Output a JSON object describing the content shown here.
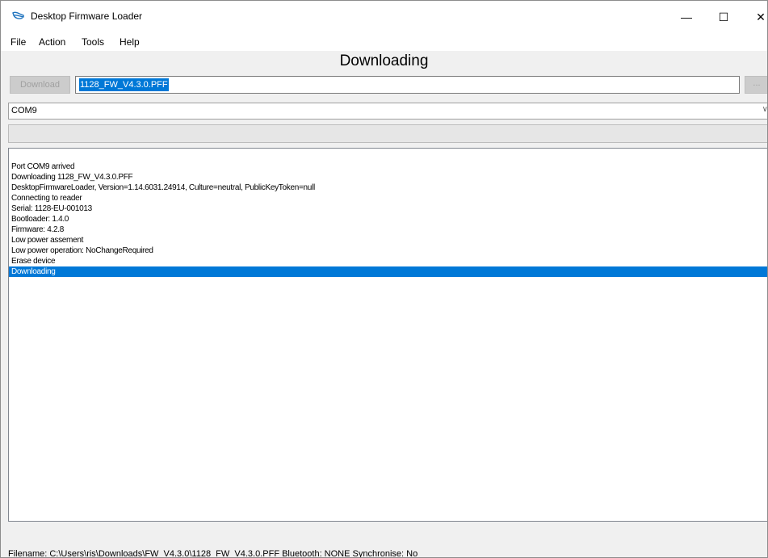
{
  "window": {
    "title": "Desktop Firmware Loader",
    "controls": {
      "minimize": "—",
      "maximize": "☐",
      "close": "✕"
    }
  },
  "menu": [
    {
      "label": "File"
    },
    {
      "label": "Action"
    },
    {
      "label": "Tools"
    },
    {
      "label": "Help"
    }
  ],
  "header": {
    "title": "Downloading"
  },
  "toolbar": {
    "download_label": "Download",
    "file_value": "1128_FW_V4.3.0.PFF",
    "browse_label": "..."
  },
  "port": {
    "selected": "COM9"
  },
  "progress": {
    "value": 0
  },
  "log": {
    "lines": [
      "Port COM9 arrived",
      "Downloading 1128_FW_V4.3.0.PFF",
      "DesktopFirmwareLoader, Version=1.14.6031.24914, Culture=neutral, PublicKeyToken=null",
      "Connecting to reader",
      "Serial: 1128-EU-001013",
      "Bootloader: 1.4.0",
      "Firmware: 4.2.8",
      "Low power assement",
      "Low power operation: NoChangeRequired",
      "Erase device",
      "Downloading"
    ],
    "selected_index": 10
  },
  "status": {
    "text": "Filename: C:\\Users\\ris\\Downloads\\FW_V4.3.0\\1128_FW_V4.3.0.PFF  Bluetooth: NONE  Synchronise: No"
  },
  "colors": {
    "selection": "#0078d7",
    "window_bg": "#f0f0f0"
  }
}
